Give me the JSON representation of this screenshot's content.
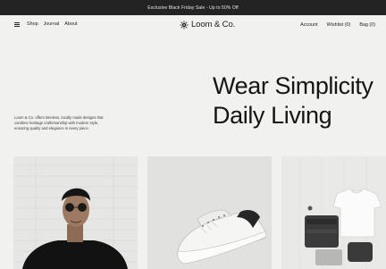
{
  "promo": {
    "text": "Exclusive Black Friday Sale - Up to 50% Off"
  },
  "nav": {
    "menu_icon": "hamburger-menu-icon",
    "links": [
      "Shop",
      "Journal",
      "About"
    ],
    "brand": "Loom & Co.",
    "brand_icon": "sunburst-logo-icon",
    "right_links": [
      "Account",
      "Wishlist (0)",
      "Bag (0)"
    ]
  },
  "hero": {
    "title_line1": "Wear Simplicity",
    "title_line2": "Daily Living",
    "description": "Loom & Co. offers timeless, locally made designs that combine heritage craftsmanship with modern style, ensuring quality and elegance in every piece."
  },
  "gallery": {
    "items": [
      {
        "subject": "model-portrait-image"
      },
      {
        "subject": "sneaker-image"
      },
      {
        "subject": "folded-clothes-image"
      }
    ]
  }
}
